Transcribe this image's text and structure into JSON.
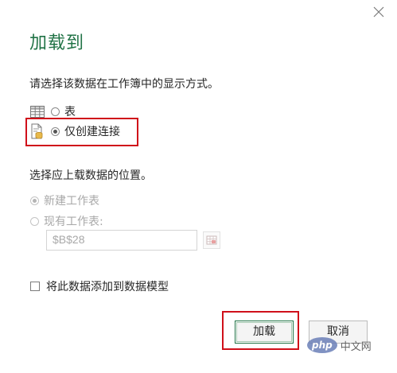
{
  "dialog": {
    "title": "加载到",
    "display_prompt": "请选择该数据在工作簿中的显示方式。",
    "display_options": [
      {
        "label": "表",
        "selected": false,
        "icon": "table-icon"
      },
      {
        "label": "仅创建连接",
        "selected": true,
        "icon": "connection-only-icon"
      }
    ],
    "location_prompt": "选择应上载数据的位置。",
    "location_options": [
      {
        "label": "新建工作表",
        "selected": true,
        "enabled": false
      },
      {
        "label": "现有工作表:",
        "selected": false,
        "enabled": false
      }
    ],
    "cell_reference": "$B$28",
    "data_model_checkbox": {
      "label": "将此数据添加到数据模型",
      "checked": false
    },
    "buttons": {
      "load": "加载",
      "cancel": "取消"
    }
  },
  "watermark": {
    "logo": "php",
    "text": "中文网"
  },
  "colors": {
    "accent": "#217346",
    "highlight": "#d0101a",
    "disabled_text": "#a8a8a8"
  }
}
